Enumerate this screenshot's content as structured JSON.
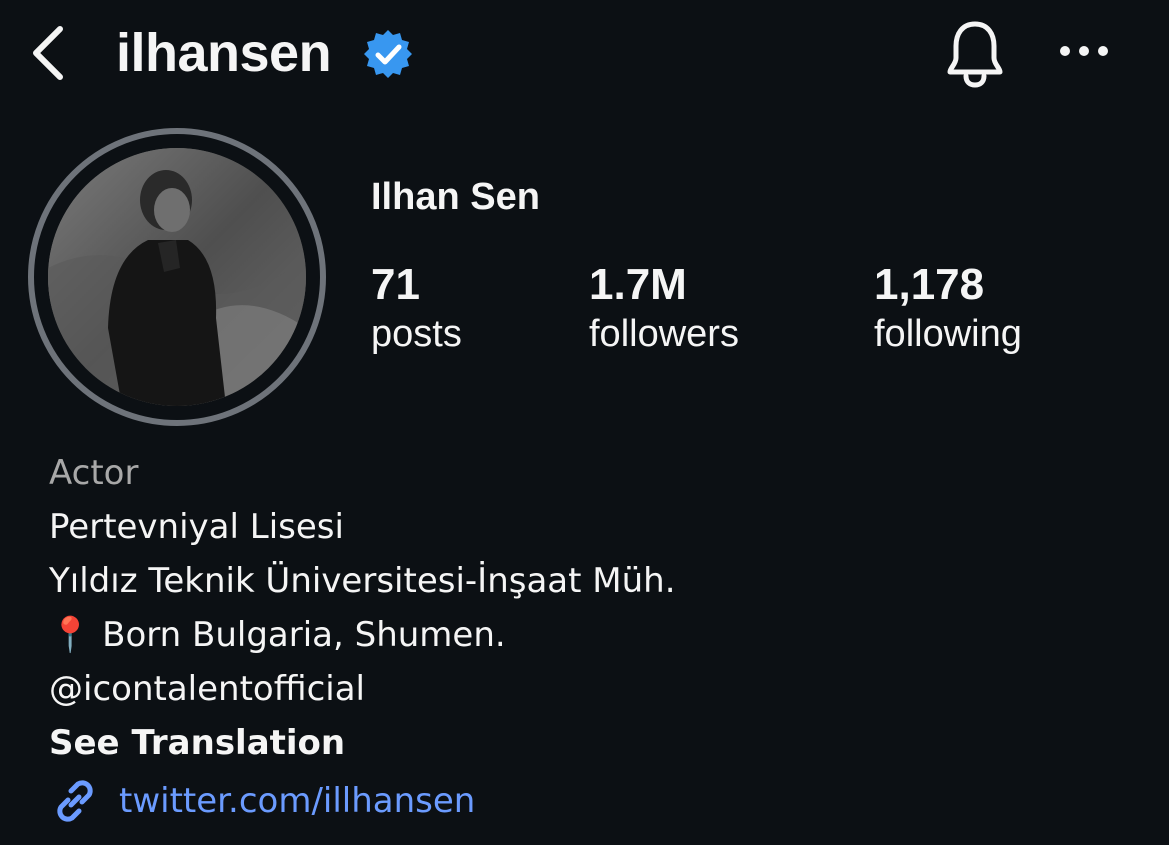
{
  "header": {
    "username": "ilhansen",
    "verified": true,
    "icons": [
      "back-chevron-icon",
      "verified-badge-icon",
      "bell-icon",
      "more-icon"
    ]
  },
  "profile": {
    "display_name": "Ilhan Sen",
    "stats": {
      "posts": {
        "value": "71",
        "label": "posts"
      },
      "followers": {
        "value": "1.7M",
        "label": "followers"
      },
      "following": {
        "value": "1,178",
        "label": "following"
      }
    }
  },
  "bio": {
    "category": "Actor",
    "lines": [
      "Pertevniyal Lisesi",
      "Yıldız Teknik Üniversitesi-İnşaat Müh.",
      "📍 Born Bulgaria, Shumen.",
      "@icontalentofficial"
    ],
    "see_translation": "See Translation",
    "link": "twitter.com/illhansen"
  },
  "colors": {
    "background": "#0c1014",
    "text": "#f5f5f5",
    "muted": "#a8a8a8",
    "link": "#6b9bff",
    "verified": "#3897f0",
    "avatar_ring": "#6e737a"
  }
}
